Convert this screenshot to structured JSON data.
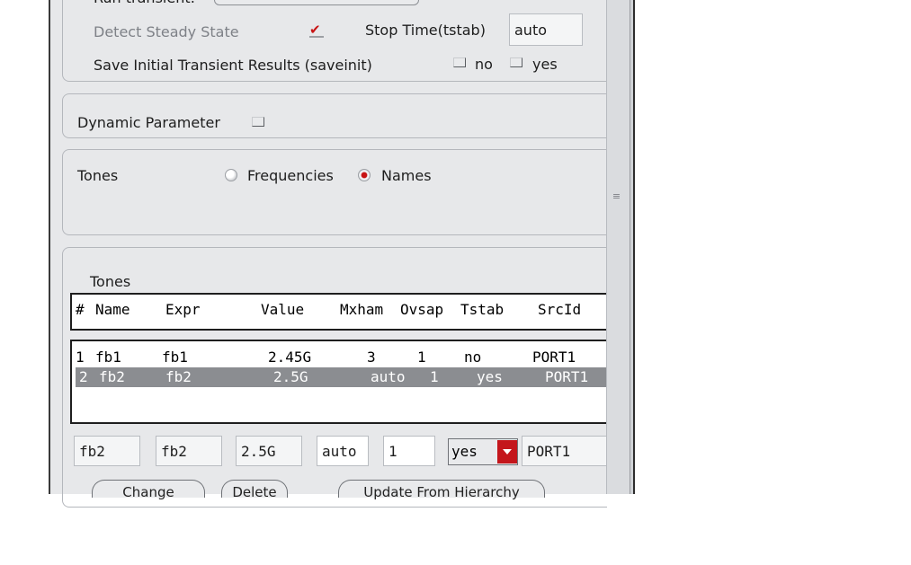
{
  "top_row": {
    "label": "Run transient:"
  },
  "steady_state": {
    "detect_label": "Detect Steady State",
    "stop_time_label": "Stop Time(tstab)",
    "stop_time_value": "auto"
  },
  "saveinit": {
    "label": "Save Initial Transient Results (saveinit)",
    "no_label": "no",
    "yes_label": "yes"
  },
  "dynamic_parameter": {
    "label": "Dynamic Parameter"
  },
  "tones_mode": {
    "label": "Tones",
    "frequencies_label": "Frequencies",
    "names_label": "Names",
    "selected": "Names"
  },
  "tones_table": {
    "title": "Tones",
    "columns": [
      "#",
      "Name",
      "Expr",
      "Value",
      "Mxham",
      "Ovsap",
      "Tstab",
      "SrcId"
    ],
    "rows": [
      {
        "num": "1",
        "name": "fb1",
        "expr": "fb1",
        "value": "2.45G",
        "mxham": "3",
        "ovsap": "1",
        "tstab": "no",
        "srcid": "PORT1"
      },
      {
        "num": "2",
        "name": "fb2",
        "expr": "fb2",
        "value": "2.5G",
        "mxham": "auto",
        "ovsap": "1",
        "tstab": "yes",
        "srcid": "PORT1"
      }
    ],
    "selected_row": 2
  },
  "editor": {
    "name": "fb2",
    "expr": "fb2",
    "value": "2.5G",
    "mxham": "auto",
    "ovsap": "1",
    "tstab": "yes",
    "srcid": "PORT1"
  },
  "buttons": {
    "change": "Change",
    "delete": "Delete",
    "update": "Update From Hierarchy"
  },
  "colors": {
    "accent": "#c4161c",
    "selection": "#8b8d91",
    "panel": "#e7e8ea"
  }
}
